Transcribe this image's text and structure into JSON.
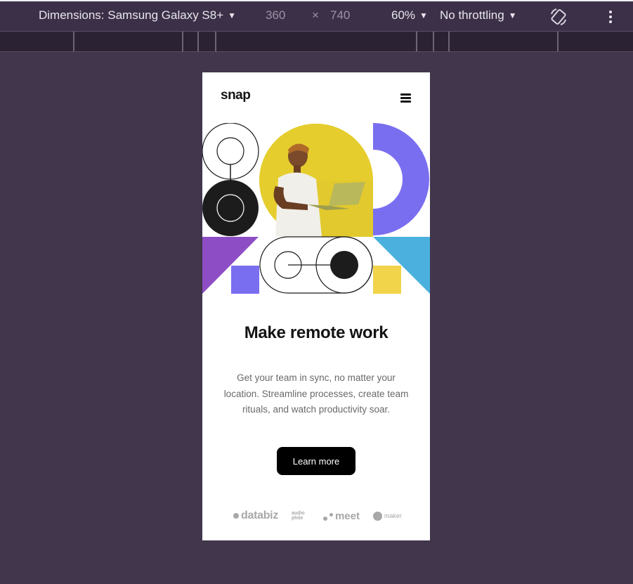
{
  "devtools": {
    "dimensions_label": "Dimensions: Samsung Galaxy S8+",
    "width": "360",
    "height": "740",
    "times": "×",
    "zoom": "60%",
    "throttling": "No throttling"
  },
  "site": {
    "logo": "snap",
    "hero": {
      "title": "Make remote work",
      "description": "Get your team in sync, no matter your location. Streamline processes, create team rituals, and watch productivity soar.",
      "cta_label": "Learn more"
    },
    "clients": {
      "databiz": "databiz",
      "audiophile": "audio phile",
      "meet": "meet",
      "maker": "maker"
    }
  }
}
